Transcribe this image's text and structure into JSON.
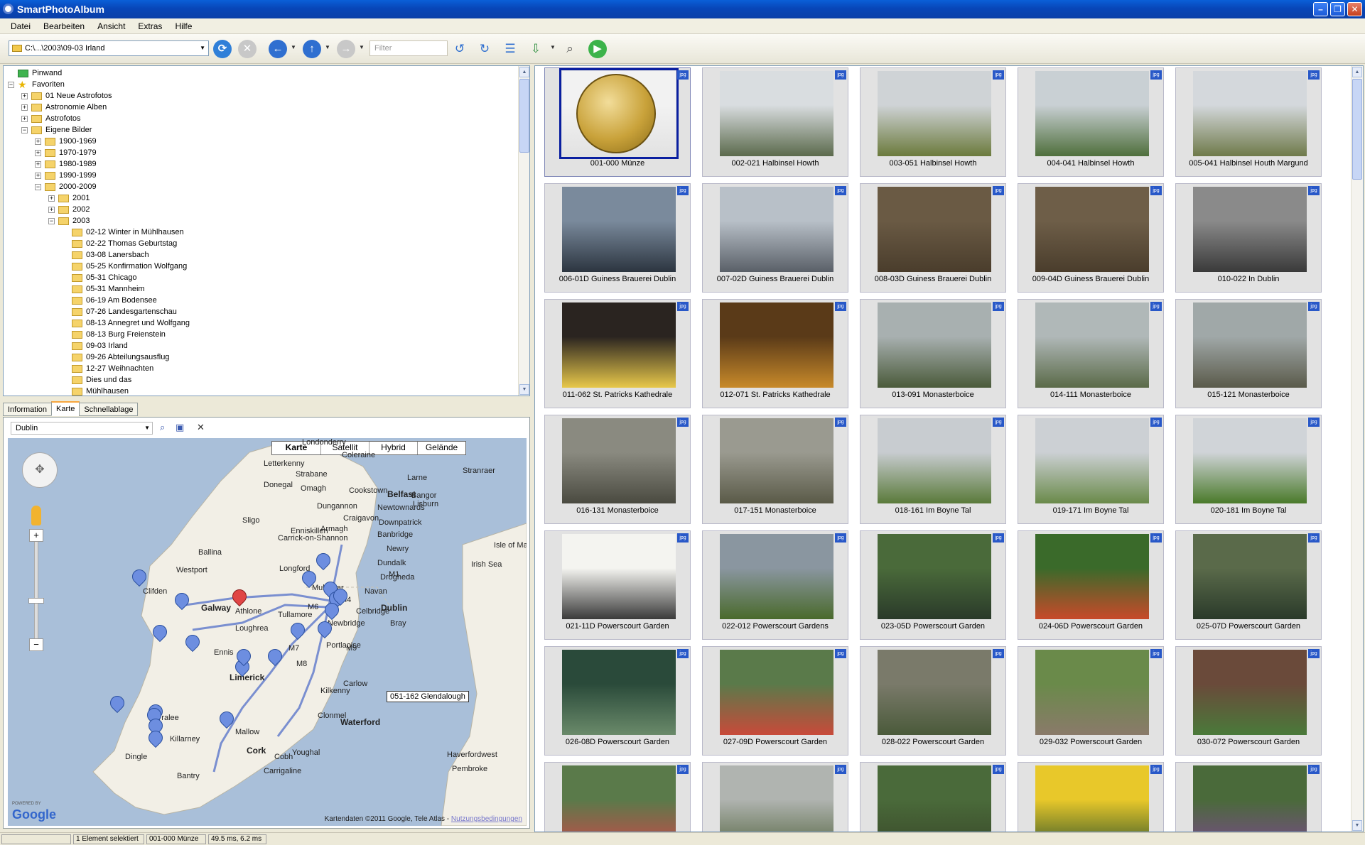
{
  "window": {
    "title": "SmartPhotoAlbum"
  },
  "menu": [
    "Datei",
    "Bearbeiten",
    "Ansicht",
    "Extras",
    "Hilfe"
  ],
  "toolbar": {
    "path": "C:\\...\\2003\\09-03 Irland",
    "filter_placeholder": "Filter"
  },
  "tree": [
    {
      "label": "Pinwand",
      "depth": 0,
      "expander": "",
      "icon": "pin-board"
    },
    {
      "label": "Favoriten",
      "depth": 0,
      "expander": "−",
      "icon": "star"
    },
    {
      "label": "01 Neue Astrofotos",
      "depth": 1,
      "expander": "+",
      "icon": "folder"
    },
    {
      "label": "Astronomie Alben",
      "depth": 1,
      "expander": "+",
      "icon": "folder"
    },
    {
      "label": "Astrofotos",
      "depth": 1,
      "expander": "+",
      "icon": "folder"
    },
    {
      "label": "Eigene Bilder",
      "depth": 1,
      "expander": "−",
      "icon": "folder"
    },
    {
      "label": "1900-1969",
      "depth": 2,
      "expander": "+",
      "icon": "folder"
    },
    {
      "label": "1970-1979",
      "depth": 2,
      "expander": "+",
      "icon": "folder"
    },
    {
      "label": "1980-1989",
      "depth": 2,
      "expander": "+",
      "icon": "folder"
    },
    {
      "label": "1990-1999",
      "depth": 2,
      "expander": "+",
      "icon": "folder"
    },
    {
      "label": "2000-2009",
      "depth": 2,
      "expander": "−",
      "icon": "folder"
    },
    {
      "label": "2001",
      "depth": 3,
      "expander": "+",
      "icon": "folder"
    },
    {
      "label": "2002",
      "depth": 3,
      "expander": "+",
      "icon": "folder"
    },
    {
      "label": "2003",
      "depth": 3,
      "expander": "−",
      "icon": "folder"
    },
    {
      "label": "02-12 Winter in Mühlhausen",
      "depth": 4,
      "expander": "",
      "icon": "folder"
    },
    {
      "label": "02-22 Thomas Geburtstag",
      "depth": 4,
      "expander": "",
      "icon": "folder"
    },
    {
      "label": "03-08 Lanersbach",
      "depth": 4,
      "expander": "",
      "icon": "folder"
    },
    {
      "label": "05-25 Konfirmation Wolfgang",
      "depth": 4,
      "expander": "",
      "icon": "folder"
    },
    {
      "label": "05-31 Chicago",
      "depth": 4,
      "expander": "",
      "icon": "folder"
    },
    {
      "label": "05-31 Mannheim",
      "depth": 4,
      "expander": "",
      "icon": "folder"
    },
    {
      "label": "06-19 Am Bodensee",
      "depth": 4,
      "expander": "",
      "icon": "folder"
    },
    {
      "label": "07-26 Landesgartenschau",
      "depth": 4,
      "expander": "",
      "icon": "folder"
    },
    {
      "label": "08-13 Annegret und Wolfgang",
      "depth": 4,
      "expander": "",
      "icon": "folder"
    },
    {
      "label": "08-13 Burg Freienstein",
      "depth": 4,
      "expander": "",
      "icon": "folder"
    },
    {
      "label": "09-03 Irland",
      "depth": 4,
      "expander": "",
      "icon": "folder"
    },
    {
      "label": "09-26 Abteilungsausflug",
      "depth": 4,
      "expander": "",
      "icon": "folder"
    },
    {
      "label": "12-27 Weihnachten",
      "depth": 4,
      "expander": "",
      "icon": "folder"
    },
    {
      "label": "Dies und das",
      "depth": 4,
      "expander": "",
      "icon": "folder"
    },
    {
      "label": "Mühlhausen",
      "depth": 4,
      "expander": "",
      "icon": "folder"
    }
  ],
  "tabs": [
    {
      "label": "Information",
      "active": false
    },
    {
      "label": "Karte",
      "active": true
    },
    {
      "label": "Schnellablage",
      "active": false
    }
  ],
  "map": {
    "search_value": "Dublin",
    "types": [
      {
        "label": "Karte",
        "active": true
      },
      {
        "label": "Satellit",
        "active": false
      },
      {
        "label": "Hybrid",
        "active": false
      },
      {
        "label": "Gelände",
        "active": false
      }
    ],
    "tooltip": "051-162 Glendalough",
    "copyright": "Kartendaten ©2011 Google, Tele Atlas - ",
    "copyright_link": "Nutzungsbedingungen",
    "logo": "Google",
    "logo_caption": "POWERED BY",
    "places": [
      {
        "label": "Londonderry",
        "big": false
      },
      {
        "label": "Belfast",
        "big": true
      },
      {
        "label": "Lisburn",
        "big": false
      },
      {
        "label": "Letterkenny",
        "big": false
      },
      {
        "label": "Coleraine",
        "big": false
      },
      {
        "label": "Omagh",
        "big": false
      },
      {
        "label": "Strabane",
        "big": false
      },
      {
        "label": "Cookstown",
        "big": false
      },
      {
        "label": "Donegal",
        "big": false
      },
      {
        "label": "Dungannon",
        "big": false
      },
      {
        "label": "Craigavon",
        "big": false
      },
      {
        "label": "Downpatrick",
        "big": false
      },
      {
        "label": "Newtownards",
        "big": false
      },
      {
        "label": "Bangor",
        "big": false
      },
      {
        "label": "Larne",
        "big": false
      },
      {
        "label": "Stranraer",
        "big": false
      },
      {
        "label": "Sligo",
        "big": false
      },
      {
        "label": "Enniskillen",
        "big": false
      },
      {
        "label": "Armagh",
        "big": false
      },
      {
        "label": "Banbridge",
        "big": false
      },
      {
        "label": "Newry",
        "big": false
      },
      {
        "label": "Ballina",
        "big": false
      },
      {
        "label": "Carrick-on-Shannon",
        "big": false
      },
      {
        "label": "Dundalk",
        "big": false
      },
      {
        "label": "Isle of Man",
        "big": false
      },
      {
        "label": "Westport",
        "big": false
      },
      {
        "label": "Longford",
        "big": false
      },
      {
        "label": "Drogheda",
        "big": false
      },
      {
        "label": "Clifden",
        "big": false
      },
      {
        "label": "Navan",
        "big": false
      },
      {
        "label": "Irish Sea",
        "big": false
      },
      {
        "label": "Mullingar",
        "big": false
      },
      {
        "label": "Galway",
        "big": true
      },
      {
        "label": "Athlone",
        "big": false
      },
      {
        "label": "Tullamore",
        "big": false
      },
      {
        "label": "Dublin",
        "big": true
      },
      {
        "label": "Loughrea",
        "big": false
      },
      {
        "label": "Newbridge",
        "big": false
      },
      {
        "label": "Celbridge",
        "big": false
      },
      {
        "label": "Bray",
        "big": false
      },
      {
        "label": "Ennis",
        "big": false
      },
      {
        "label": "Portlaoise",
        "big": false
      },
      {
        "label": "Limerick",
        "big": true
      },
      {
        "label": "Carlow",
        "big": false
      },
      {
        "label": "Kilkenny",
        "big": false
      },
      {
        "label": "Clonmel",
        "big": false
      },
      {
        "label": "Waterford",
        "big": true
      },
      {
        "label": "Tralee",
        "big": false
      },
      {
        "label": "Dingle",
        "big": false
      },
      {
        "label": "Killarney",
        "big": false
      },
      {
        "label": "Mallow",
        "big": false
      },
      {
        "label": "Cork",
        "big": true
      },
      {
        "label": "Cobh",
        "big": false
      },
      {
        "label": "Youghal",
        "big": false
      },
      {
        "label": "Bantry",
        "big": false
      },
      {
        "label": "Carrigaline",
        "big": false
      },
      {
        "label": "Haverfordwest",
        "big": false
      },
      {
        "label": "Pembroke",
        "big": false
      },
      {
        "label": "M4",
        "big": false
      },
      {
        "label": "M6",
        "big": false
      },
      {
        "label": "M7",
        "big": false
      },
      {
        "label": "M8",
        "big": false
      },
      {
        "label": "M9",
        "big": false
      },
      {
        "label": "M1",
        "big": false
      }
    ]
  },
  "photos": [
    {
      "caption": "001-000 Münze",
      "badge": "jpg",
      "tone": [
        "#f2f2f2",
        "#e2e2e2"
      ],
      "selected": true,
      "coin": true
    },
    {
      "caption": "002-021 Halbinsel Howth",
      "badge": "jpg",
      "tone": [
        "#d9dde0",
        "#5b6a4c"
      ]
    },
    {
      "caption": "003-051 Halbinsel Howth",
      "badge": "jpg",
      "tone": [
        "#cfd3d6",
        "#6b7a3c"
      ]
    },
    {
      "caption": "004-041 Halbinsel Howth",
      "badge": "jpg",
      "tone": [
        "#c9d0d4",
        "#4f6f3c"
      ]
    },
    {
      "caption": "005-041 Halbinsel Houth Margund",
      "badge": "jpg",
      "tone": [
        "#d4d8dc",
        "#6f7a4a"
      ]
    },
    {
      "caption": "006-01D Guiness Brauerei Dublin",
      "badge": "jpg",
      "tone": [
        "#7a8a9c",
        "#2c3540"
      ]
    },
    {
      "caption": "007-02D Guiness Brauerei Dublin",
      "badge": "jpg",
      "tone": [
        "#b8c0c8",
        "#5a6068"
      ]
    },
    {
      "caption": "008-03D Guiness Brauerei Dublin",
      "badge": "jpg",
      "tone": [
        "#6a5a44",
        "#4a3d2c"
      ]
    },
    {
      "caption": "009-04D Guiness Brauerei Dublin",
      "badge": "jpg",
      "tone": [
        "#6e5e48",
        "#4a3d2c"
      ]
    },
    {
      "caption": "010-022 In Dublin",
      "badge": "jpg",
      "tone": [
        "#8a8a8a",
        "#3a3a3a"
      ]
    },
    {
      "caption": "011-062 St. Patricks Kathedrale",
      "badge": "jpg",
      "tone": [
        "#2a2420",
        "#e8c84a"
      ]
    },
    {
      "caption": "012-071 St. Patricks Kathedrale",
      "badge": "jpg",
      "tone": [
        "#5a3a18",
        "#c88a2a"
      ]
    },
    {
      "caption": "013-091 Monasterboice",
      "badge": "jpg",
      "tone": [
        "#a8b0b0",
        "#4a5a3a"
      ]
    },
    {
      "caption": "014-111 Monasterboice",
      "badge": "jpg",
      "tone": [
        "#b0b8b8",
        "#5a6a48"
      ]
    },
    {
      "caption": "015-121 Monasterboice",
      "badge": "jpg",
      "tone": [
        "#a0a8a8",
        "#5a5a4a"
      ]
    },
    {
      "caption": "016-131 Monasterboice",
      "badge": "jpg",
      "tone": [
        "#8a8a80",
        "#4a4a40"
      ]
    },
    {
      "caption": "017-151 Monasterboice",
      "badge": "jpg",
      "tone": [
        "#9a9a90",
        "#5a5a48"
      ]
    },
    {
      "caption": "018-161 Im Boyne Tal",
      "badge": "jpg",
      "tone": [
        "#c8ccd0",
        "#5a7a3a"
      ]
    },
    {
      "caption": "019-171 Im Boyne Tal",
      "badge": "jpg",
      "tone": [
        "#ccd0d4",
        "#6a8a4a"
      ]
    },
    {
      "caption": "020-181 Im Boyne Tal",
      "badge": "jpg",
      "tone": [
        "#d0d4d8",
        "#4a7a2a"
      ]
    },
    {
      "caption": "021-11D Powerscourt Garden",
      "badge": "jpg",
      "tone": [
        "#f4f4f0",
        "#3a3a3a"
      ]
    },
    {
      "caption": "022-012 Powerscourt Gardens",
      "badge": "jpg",
      "tone": [
        "#8a96a0",
        "#4a6a2c"
      ]
    },
    {
      "caption": "023-05D Powerscourt Garden",
      "badge": "jpg",
      "tone": [
        "#4a6a3a",
        "#2a3a2a"
      ]
    },
    {
      "caption": "024-06D Powerscourt Garden",
      "badge": "jpg",
      "tone": [
        "#3a6a2a",
        "#c84a2a"
      ]
    },
    {
      "caption": "025-07D Powerscourt Garden",
      "badge": "jpg",
      "tone": [
        "#5a6a4a",
        "#2a3a2a"
      ]
    },
    {
      "caption": "026-08D Powerscourt Garden",
      "badge": "jpg",
      "tone": [
        "#2a4a3a",
        "#6a8a6a"
      ]
    },
    {
      "caption": "027-09D Powerscourt Garden",
      "badge": "jpg",
      "tone": [
        "#5a7a4a",
        "#c84a3a"
      ]
    },
    {
      "caption": "028-022 Powerscourt Garden",
      "badge": "jpg",
      "tone": [
        "#7a7a6a",
        "#4a5a3a"
      ]
    },
    {
      "caption": "029-032 Powerscourt Garden",
      "badge": "jpg",
      "tone": [
        "#6a8a4a",
        "#8a7a6a"
      ]
    },
    {
      "caption": "030-072 Powerscourt Garden",
      "badge": "jpg",
      "tone": [
        "#6a4a3a",
        "#4a7a3a"
      ]
    },
    {
      "caption": "",
      "badge": "jpg",
      "tone": [
        "#5a7a4a",
        "#c84a4a"
      ]
    },
    {
      "caption": "",
      "badge": "jpg",
      "tone": [
        "#b0b4b0",
        "#5a6a48"
      ]
    },
    {
      "caption": "",
      "badge": "jpg",
      "tone": [
        "#4a6a3a",
        "#3a4a2a"
      ]
    },
    {
      "caption": "",
      "badge": "jpg",
      "tone": [
        "#e8c82a",
        "#3a5a2a"
      ]
    },
    {
      "caption": "",
      "badge": "jpg",
      "tone": [
        "#4a6a3a",
        "#7a4a8a"
      ]
    }
  ],
  "status": [
    "",
    "1 Element selektiert",
    "001-000 Münze",
    "49.5 ms, 6.2 ms"
  ],
  "colors": {
    "selection": "#0a1fa0",
    "title_bar": "#0846b8",
    "map_water": "#a9bfd9",
    "map_land": "#f2efe6",
    "pin": "#6d8ee0",
    "pin_selected": "#e04545"
  }
}
